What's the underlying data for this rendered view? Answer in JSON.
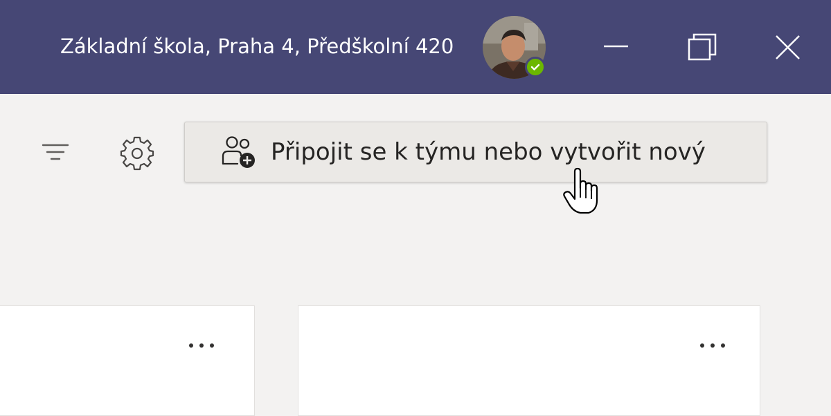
{
  "titlebar": {
    "org_name": "Základní škola, Praha 4, Předškolní 420",
    "presence_status": "available",
    "presence_color": "#6bb700",
    "window_controls": {
      "minimize_icon": "minimize-icon",
      "maximize_icon": "restore-icon",
      "close_icon": "close-icon"
    }
  },
  "toolbar": {
    "filter_icon": "filter-icon",
    "settings_icon": "gear-icon",
    "join_button_label": "Připojit se k týmu nebo vytvořit nový",
    "join_button_icon": "people-add-icon"
  },
  "teams": {
    "cards": [
      {
        "more_icon": "more-options-icon"
      },
      {
        "more_icon": "more-options-icon"
      }
    ]
  },
  "colors": {
    "titlebar_bg": "#464775",
    "page_bg": "#f3f2f1",
    "button_bg": "#ebe9e6"
  }
}
